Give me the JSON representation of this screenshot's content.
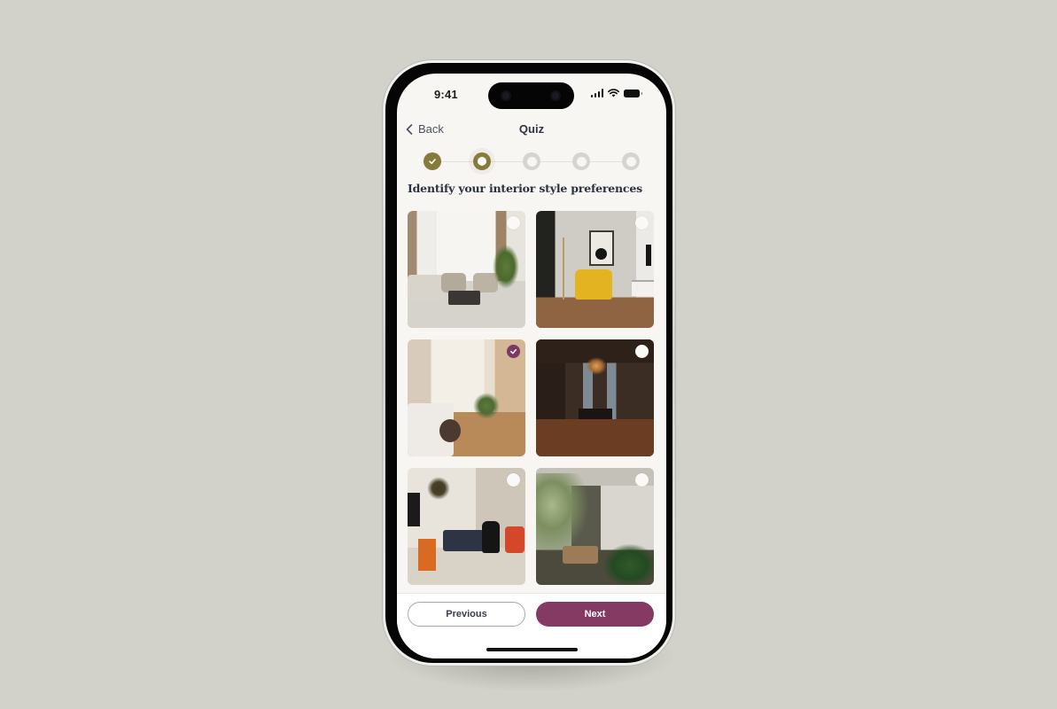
{
  "status_bar": {
    "time": "9:41",
    "icons": [
      "cellular-signal-icon",
      "wifi-icon",
      "battery-icon"
    ]
  },
  "nav": {
    "back_label": "Back",
    "back_icon": "chevron-left-icon",
    "title": "Quiz"
  },
  "stepper": {
    "total_steps": 5,
    "current_step": 2,
    "steps": [
      {
        "state": "completed"
      },
      {
        "state": "current"
      },
      {
        "state": "upcoming"
      },
      {
        "state": "upcoming"
      },
      {
        "state": "upcoming"
      }
    ]
  },
  "question": "Identify your interior style preferences",
  "options": [
    {
      "description": "Bright living room with beige sofas, tall windows and plant",
      "selected": false
    },
    {
      "description": "Minimal room with yellow armchair and abstract art",
      "selected": false
    },
    {
      "description": "Sunny bay-window bedroom with plants",
      "selected": true
    },
    {
      "description": "Dark ornate room with chandelier and wood paneling",
      "selected": false
    },
    {
      "description": "Eclectic living room with colorful furniture",
      "selected": false
    },
    {
      "description": "Lush patio with tropical plants and rattan chairs",
      "selected": false
    }
  ],
  "footer": {
    "previous_label": "Previous",
    "next_label": "Next"
  },
  "colors": {
    "accent_primary": "#843a62",
    "stepper_active": "#857b3c",
    "stepper_inactive": "#d6d4d0",
    "background": "#d3d2ca",
    "screen_background": "#f8f6f2"
  }
}
